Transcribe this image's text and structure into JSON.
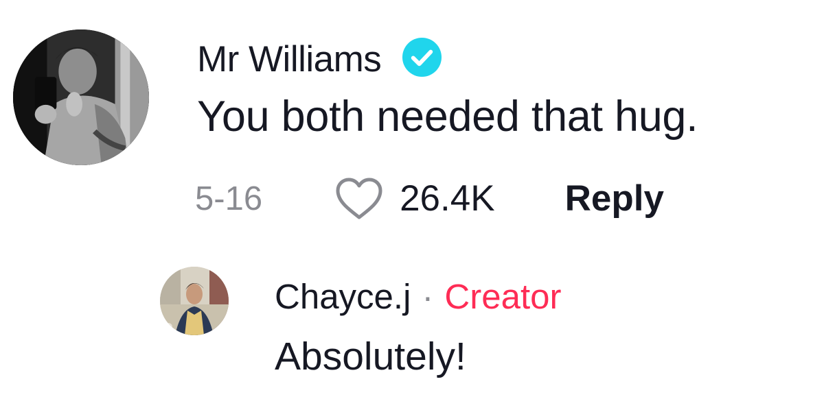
{
  "comment": {
    "username": "Mr Williams",
    "verified_icon": "verified-check-icon",
    "text": "You both needed that hug.",
    "date": "5-16",
    "likes": "26.4K",
    "reply_label": "Reply",
    "colors": {
      "verified": "#20d5ec",
      "meta_gray": "#8a8b91"
    }
  },
  "reply": {
    "username": "Chayce.j",
    "separator": "·",
    "badge": "Creator",
    "text": "Absolutely!",
    "colors": {
      "badge": "#fe2c55"
    }
  }
}
